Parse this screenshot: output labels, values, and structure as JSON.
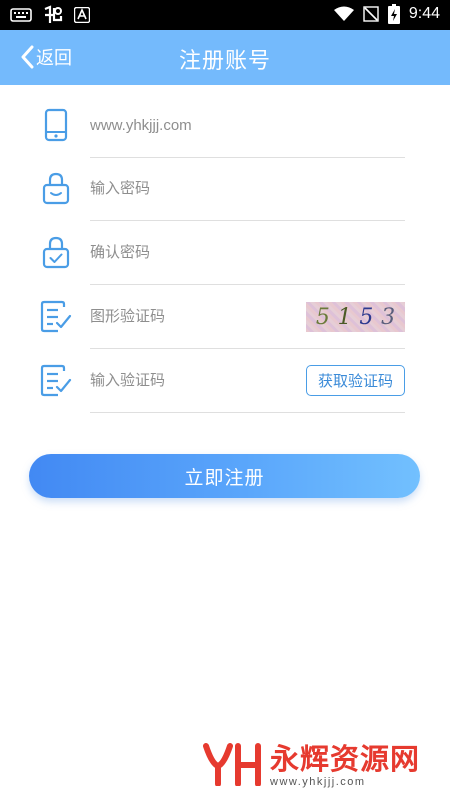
{
  "status_bar": {
    "time": "9:44",
    "icons": [
      "keyboard-icon",
      "app-icon",
      "font-icon",
      "wifi-icon",
      "no-signal-icon",
      "battery-charging-icon"
    ]
  },
  "header": {
    "back_label": "返回",
    "title": "注册账号"
  },
  "form": {
    "account": {
      "icon": "phone-icon",
      "placeholder": "www.yhkjjj.com",
      "value": ""
    },
    "password": {
      "icon": "lock-icon",
      "placeholder": "输入密码",
      "value": ""
    },
    "confirm_password": {
      "icon": "lock-check-icon",
      "placeholder": "确认密码",
      "value": ""
    },
    "captcha": {
      "icon": "edit-check-icon",
      "placeholder": "图形验证码",
      "value": "",
      "image_digits": [
        "5",
        "1",
        "5",
        "3"
      ]
    },
    "sms_code": {
      "icon": "edit-check-icon",
      "placeholder": "输入验证码",
      "value": "",
      "button_label": "获取验证码"
    }
  },
  "submit_label": "立即注册",
  "watermark": {
    "name": "永辉资源网",
    "url": "www.yhkjjj.com"
  },
  "colors": {
    "header_bg": "#74bafc",
    "icon_blue": "#4a9de6",
    "button_gradient_start": "#4289f3",
    "button_gradient_end": "#72c0fe",
    "watermark_red": "#e63a2f"
  }
}
